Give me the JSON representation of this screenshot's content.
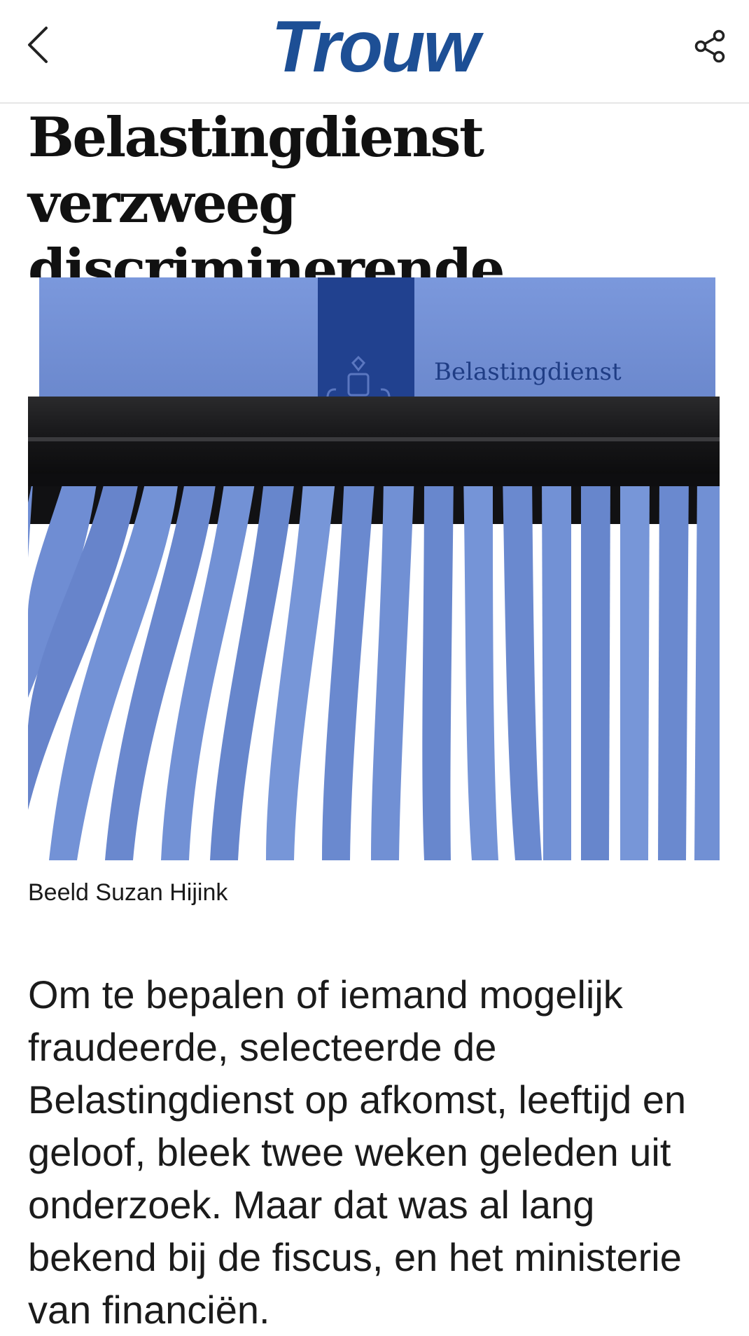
{
  "header": {
    "logo_text": "Trouw",
    "logo_color": "#1d4f95",
    "back_icon": "chevron-left-icon",
    "share_icon": "share-icon"
  },
  "article": {
    "title": "Belastingdienst verzweeg discriminerende criteria",
    "image": {
      "envelope_label": "Belastingdienst",
      "paper_color": "#6f8ed4",
      "band_color": "#1f3f8c",
      "shredder_color": "#1c1c1e"
    },
    "caption": "Beeld Suzan Hijink",
    "intro": "Om te bepalen of iemand mogelijk fraudeerde, selecteerde de Belastingdienst op afkomst, leeftijd en geloof, bleek twee weken geleden uit onderzoek. Maar dat was al lang bekend bij de fiscus, en het ministerie van financiën."
  }
}
